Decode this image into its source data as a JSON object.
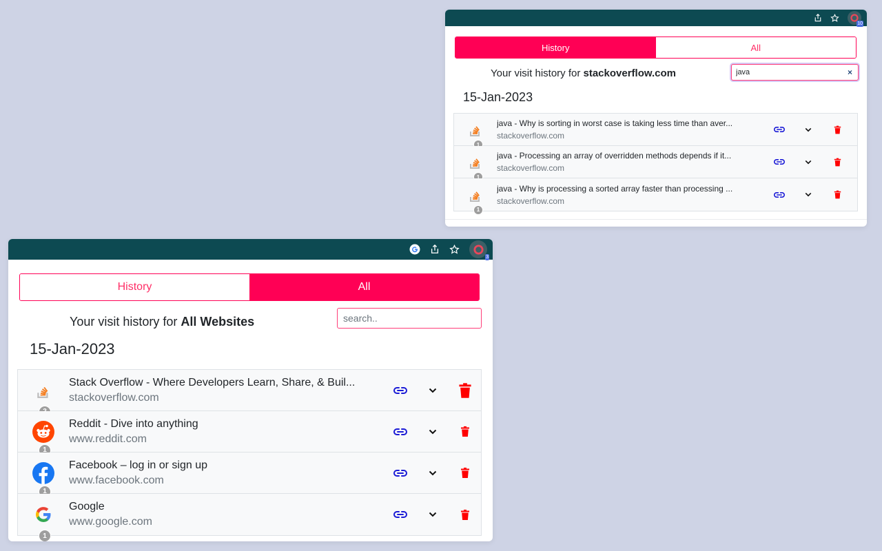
{
  "top": {
    "ext_badge": "10",
    "tabs": [
      {
        "label": "History"
      },
      {
        "label": "All"
      }
    ],
    "active_tab": "History",
    "heading_prefix": "Your visit history for ",
    "heading_site": "stackoverflow.com",
    "search": {
      "value": "java",
      "placeholder": "search.."
    },
    "clear_symbol": "×",
    "date": "15-Jan-2023",
    "items": [
      {
        "title": "java - Why is sorting in worst case is taking less time than aver...",
        "url": "stackoverflow.com",
        "count": "1",
        "icon": "stackoverflow-icon"
      },
      {
        "title": "java - Processing an array of overridden methods depends if it...",
        "url": "stackoverflow.com",
        "count": "1",
        "icon": "stackoverflow-icon"
      },
      {
        "title": "java - Why is processing a sorted array faster than processing ...",
        "url": "stackoverflow.com",
        "count": "1",
        "icon": "stackoverflow-icon"
      }
    ]
  },
  "bottom": {
    "ext_badge": "3",
    "tabs": [
      {
        "label": "History"
      },
      {
        "label": "All"
      }
    ],
    "active_tab": "All",
    "heading_prefix": "Your visit history for ",
    "heading_site": "All Websites",
    "search": {
      "value": "",
      "placeholder": "search.."
    },
    "date": "15-Jan-2023",
    "items": [
      {
        "title": "Stack Overflow - Where Developers Learn, Share, & Buil...",
        "url": "stackoverflow.com",
        "count": "2",
        "icon": "stackoverflow-icon"
      },
      {
        "title": "Reddit - Dive into anything",
        "url": "www.reddit.com",
        "count": "1",
        "icon": "reddit-icon"
      },
      {
        "title": "Facebook – log in or sign up",
        "url": "www.facebook.com",
        "count": "1",
        "icon": "facebook-icon"
      },
      {
        "title": "Google",
        "url": "www.google.com",
        "count": "1",
        "icon": "google-icon"
      }
    ]
  },
  "colors": {
    "toolbar": "#0d4a52",
    "accent": "#ff0055",
    "link_icon": "#1a1ad6",
    "delete_icon": "#ff0000",
    "page_bg": "#ced3e5"
  }
}
